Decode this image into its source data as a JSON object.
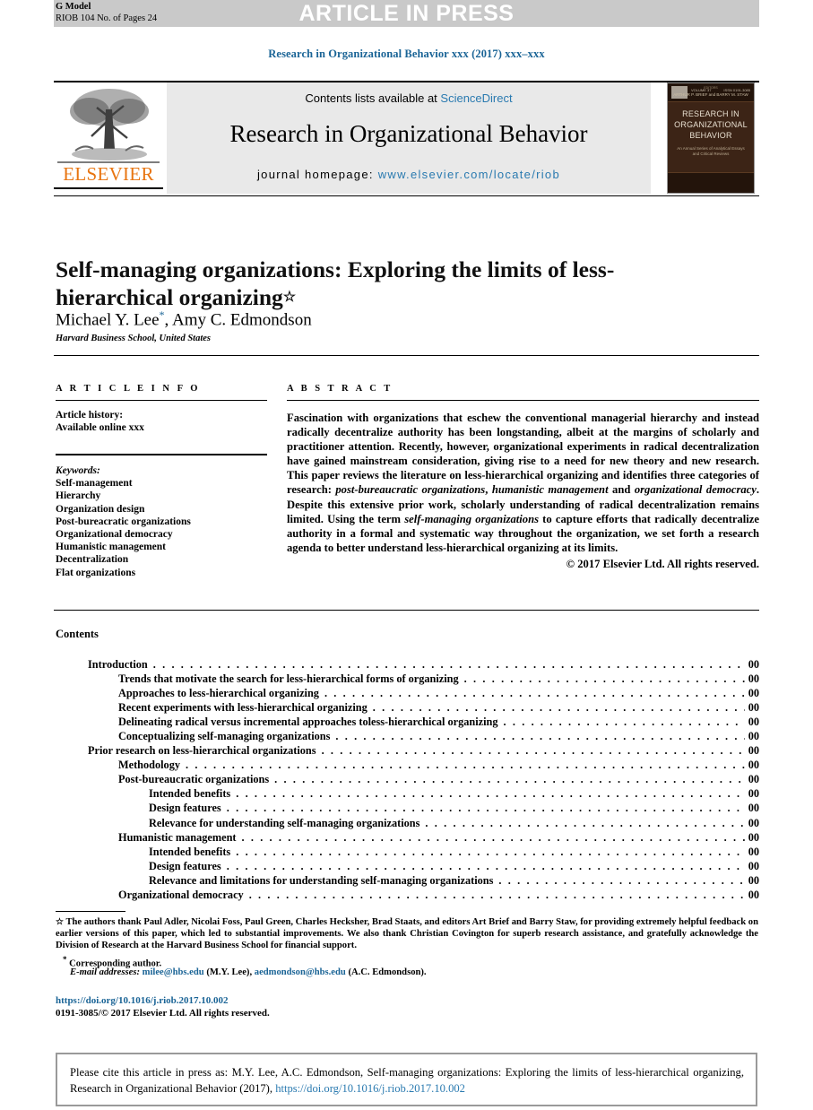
{
  "header": {
    "g_model": "G Model",
    "model_id": "RIOB 104 No. of Pages 24",
    "banner": "ARTICLE IN PRESS",
    "running_head": "Research in Organizational Behavior xxx (2017) xxx–xxx"
  },
  "masthead": {
    "contents_prefix": "Contents lists available at ",
    "sciencedirect": "ScienceDirect",
    "journal_name": "Research in Organizational Behavior",
    "homepage_label": "journal homepage: ",
    "homepage_url": "www.elsevier.com/locate/riob",
    "publisher": "ELSEVIER",
    "cover": {
      "volume": "VOLUME 37",
      "issn": "ISSN 0191-3085",
      "title_line1": "RESEARCH IN",
      "title_line2": "ORGANIZATIONAL",
      "title_line3": "BEHAVIOR",
      "subtitle": "An Annual Series of Analytical Essays and Critical Reviews",
      "editors_label": "EDITORS",
      "editors": "ARTHUR P. BRIEF and BARRY M. STAW"
    }
  },
  "article": {
    "title": "Self-managing organizations: Exploring the limits of less-hierarchical organizing",
    "title_mark": "☆",
    "authors": "Michael Y. Lee",
    "author_mark": "*",
    "authors_rest": ", Amy C. Edmondson",
    "affiliation": "Harvard Business School, United States"
  },
  "info": {
    "heading": "A R T I C L E  I N F O",
    "history_label": "Article history:",
    "history_value": "Available online xxx",
    "keywords_label": "Keywords:",
    "keywords": [
      "Self-management",
      "Hierarchy",
      "Organization design",
      "Post-bureacratic organizations",
      "Organizational democracy",
      "Humanistic management",
      "Decentralization",
      "Flat organizations"
    ]
  },
  "abstract": {
    "heading": "A B S T R A C T",
    "paragraph_1": "Fascination with organizations that eschew the conventional managerial hierarchy and instead radically decentralize authority has been longstanding, albeit at the margins of scholarly and practitioner attention. Recently, however, organizational experiments in radical decentralization have gained mainstream consideration, giving rise to a need for new theory and new research. This paper reviews the literature on less-hierarchical organizing and identifies three categories of research: ",
    "italic_1": "post-bureaucratic organizations",
    "joiner_1": ", ",
    "italic_2": "humanistic management",
    "joiner_2": " and ",
    "italic_3": "organizational democracy",
    "paragraph_2": ". Despite this extensive prior work, scholarly understanding of radical decentralization remains limited. Using the term ",
    "italic_4": "self-managing organizations",
    "paragraph_3": " to capture efforts that radically decentralize authority in a formal and systematic way throughout the organization, we set forth a research agenda to better understand less-hierarchical organizing at its limits.",
    "copyright": "© 2017 Elsevier Ltd. All rights reserved."
  },
  "contents": {
    "heading": "Contents",
    "entries": [
      {
        "label": "Introduction",
        "page": "00",
        "level": 1
      },
      {
        "label": "Trends that motivate the search for less-hierarchical forms of organizing",
        "page": "00",
        "level": 2
      },
      {
        "label": "Approaches to less-hierarchical organizing",
        "page": "00",
        "level": 2
      },
      {
        "label": "Recent experiments with less-hierarchical organizing",
        "page": "00",
        "level": 2
      },
      {
        "label": "Delineating radical versus incremental approaches toless-hierarchical organizing",
        "page": "00",
        "level": 2
      },
      {
        "label": "Conceptualizing self-managing organizations",
        "page": "00",
        "level": 2
      },
      {
        "label": "Prior research on less-hierarchical organizations",
        "page": "00",
        "level": 1
      },
      {
        "label": "Methodology",
        "page": "00",
        "level": 2
      },
      {
        "label": "Post-bureaucratic organizations",
        "page": "00",
        "level": 2
      },
      {
        "label": "Intended benefits",
        "page": "00",
        "level": 3
      },
      {
        "label": "Design features",
        "page": "00",
        "level": 3
      },
      {
        "label": "Relevance for understanding self-managing organizations",
        "page": "00",
        "level": 3
      },
      {
        "label": "Humanistic management",
        "page": "00",
        "level": 2
      },
      {
        "label": "Intended benefits",
        "page": "00",
        "level": 3
      },
      {
        "label": "Design features",
        "page": "00",
        "level": 3
      },
      {
        "label": "Relevance and limitations for understanding self-managing organizations",
        "page": "00",
        "level": 3
      },
      {
        "label": "Organizational democracy",
        "page": "00",
        "level": 2
      }
    ]
  },
  "footnotes": {
    "ack_mark": "☆",
    "acknowledgment": "The authors thank Paul Adler, Nicolai Foss, Paul Green, Charles Hecksher, Brad Staats, and editors Art Brief and Barry Staw, for providing extremely helpful feedback on earlier versions of this paper, which led to substantial improvements. We also thank Christian Covington for superb research assistance, and gratefully acknowledge the Division of Research at the Harvard Business School for financial support.",
    "corresponding_mark": "*",
    "corresponding": "Corresponding author.",
    "email_label": "E-mail addresses:",
    "email_1": "milee@hbs.edu",
    "email_1_owner": "(M.Y. Lee)",
    "email_sep": ", ",
    "email_2": "aedmondson@hbs.edu",
    "email_2_owner": "(A.C. Edmondson).",
    "doi": "https://doi.org/10.1016/j.riob.2017.10.002",
    "issn_line": "0191-3085/© 2017 Elsevier Ltd. All rights reserved."
  },
  "cite_box": {
    "text": "Please cite this article in press as: M.Y. Lee, A.C. Edmondson, Self-managing organizations: Exploring the limits of less-hierarchical organizing, Research in Organizational Behavior (2017), ",
    "doi": "https://doi.org/10.1016/j.riob.2017.10.002"
  },
  "colors": {
    "link": "#1a6496",
    "banner_bg": "#c9c9c9",
    "masthead_bg": "#e9e9e9",
    "elsevier_orange": "#e87511"
  }
}
